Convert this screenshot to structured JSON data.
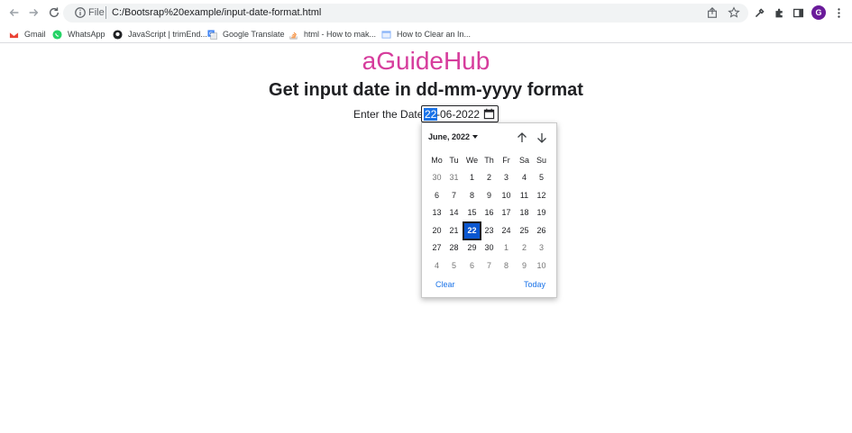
{
  "browser": {
    "scheme_label": "File",
    "url": "C:/Bootsrap%20example/input-date-format.html",
    "profile_initial": "G"
  },
  "bookmarks": [
    {
      "label": "Gmail",
      "icon": "gmail-icon"
    },
    {
      "label": "WhatsApp",
      "icon": "whatsapp-icon"
    },
    {
      "label": "JavaScript | trimEnd...",
      "icon": "github-icon"
    },
    {
      "label": "Google Translate",
      "icon": "translate-icon"
    },
    {
      "label": "html - How to mak...",
      "icon": "stackoverflow-icon"
    },
    {
      "label": "How to Clear an In...",
      "icon": "page-icon"
    }
  ],
  "page": {
    "brand": "aGuideHub",
    "heading": "Get input date in dd-mm-yyyy format",
    "field_label": "Enter the Date:",
    "date_day": "22",
    "date_rest": "-06-2022"
  },
  "calendar": {
    "month_label": "June, 2022",
    "weekdays": [
      "Mo",
      "Tu",
      "We",
      "Th",
      "Fr",
      "Sa",
      "Su"
    ],
    "weeks": [
      [
        "30",
        "31",
        "1",
        "2",
        "3",
        "4",
        "5"
      ],
      [
        "6",
        "7",
        "8",
        "9",
        "10",
        "11",
        "12"
      ],
      [
        "13",
        "14",
        "15",
        "16",
        "17",
        "18",
        "19"
      ],
      [
        "20",
        "21",
        "22",
        "23",
        "24",
        "25",
        "26"
      ],
      [
        "27",
        "28",
        "29",
        "30",
        "1",
        "2",
        "3"
      ],
      [
        "4",
        "5",
        "6",
        "7",
        "8",
        "9",
        "10"
      ]
    ],
    "muted": [
      [
        true,
        true,
        false,
        false,
        false,
        false,
        false
      ],
      [
        false,
        false,
        false,
        false,
        false,
        false,
        false
      ],
      [
        false,
        false,
        false,
        false,
        false,
        false,
        false
      ],
      [
        false,
        false,
        false,
        false,
        false,
        false,
        false
      ],
      [
        false,
        false,
        false,
        false,
        true,
        true,
        true
      ],
      [
        true,
        true,
        true,
        true,
        true,
        true,
        true
      ]
    ],
    "selected_day": "22",
    "clear_label": "Clear",
    "today_label": "Today"
  },
  "colors": {
    "brand": "#d63c9c",
    "accent": "#1a73e8",
    "selected": "#0b57d0"
  }
}
